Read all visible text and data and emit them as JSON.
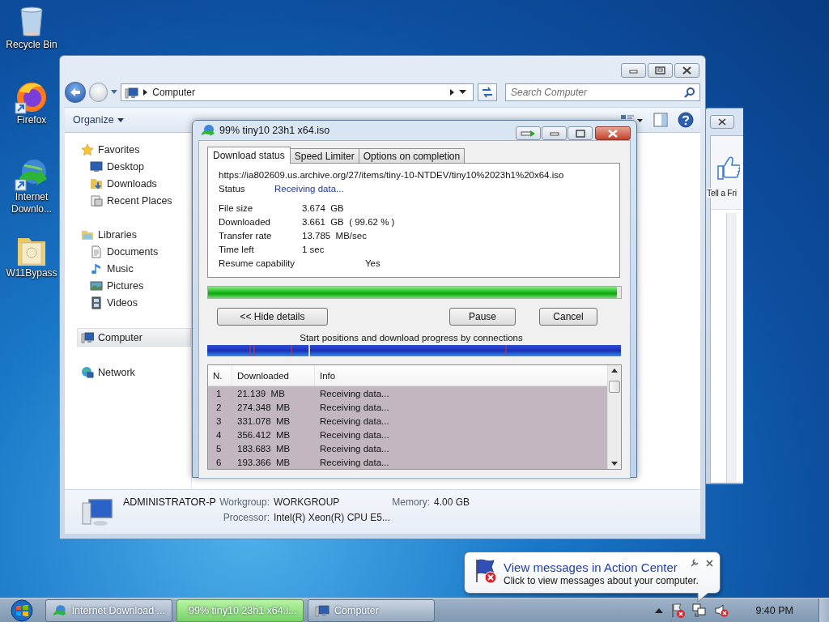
{
  "desktop_icons": [
    {
      "label": "Recycle Bin"
    },
    {
      "label": "Firefox"
    },
    {
      "label": "Internet Downlo..."
    },
    {
      "label": "W11Bypass"
    }
  ],
  "explorer": {
    "address": "Computer",
    "search": {
      "placeholder": "Search Computer"
    },
    "toolbar": [
      "Organize"
    ],
    "nav": [
      {
        "label": "Favorites",
        "selected": false,
        "children": [
          {
            "label": "Desktop",
            "selected": false
          },
          {
            "label": "Downloads",
            "selected": false
          },
          {
            "label": "Recent Places",
            "selected": false
          }
        ]
      },
      {
        "label": "Libraries",
        "selected": false,
        "children": [
          {
            "label": "Documents",
            "selected": false
          },
          {
            "label": "Music",
            "selected": false
          },
          {
            "label": "Pictures",
            "selected": false
          },
          {
            "label": "Videos",
            "selected": false
          }
        ]
      },
      {
        "label": "Computer",
        "selected": true
      },
      {
        "label": "Network",
        "selected": false
      }
    ],
    "details": {
      "name": "ADMINISTRATOR-P",
      "fields": [
        {
          "label": "Workgroup:",
          "value": "WORKGROUP"
        },
        {
          "label": "Memory:",
          "value": "4.00 GB"
        },
        {
          "label": "Processor:",
          "value": "Intel(R) Xeon(R) CPU E5..."
        }
      ]
    }
  },
  "back_window": {
    "label": "Tell a Fri"
  },
  "download_dialog": {
    "title": "99% tiny10 23h1 x64.iso",
    "tabs": [
      {
        "label": "Download status",
        "selected": true
      },
      {
        "label": "Speed Limiter",
        "selected": false
      },
      {
        "label": "Options on completion",
        "selected": false
      }
    ],
    "url": "https://ia802609.us.archive.org/27/items/tiny-10-NTDEV/tiny10%2023h1%20x64.iso",
    "status": {
      "label": "Status",
      "value": "Receiving data..."
    },
    "info": [
      {
        "label": "File size",
        "value": "3.674  GB",
        "kind": "field"
      },
      {
        "label": "Downloaded",
        "value": "3.661  GB  ( 99.62 % )",
        "kind": "field"
      },
      {
        "label": "Transfer rate",
        "value": "13.785  MB/sec",
        "kind": "field"
      },
      {
        "label": "Time left",
        "value": "1 sec",
        "kind": "field"
      },
      {
        "label": "Resume capability",
        "value": "Yes",
        "kind": "flag"
      }
    ],
    "progress": {
      "level": 0.99
    },
    "buttons": [
      "<< Hide details",
      "Pause",
      "Cancel"
    ],
    "connections_caption": "Start positions and download progress by connections",
    "table": {
      "columns": [
        "N.",
        "Downloaded",
        "Info"
      ],
      "rows": [
        [
          "1",
          "21.139  MB",
          "Receiving data..."
        ],
        [
          "2",
          "274.348  MB",
          "Receiving data..."
        ],
        [
          "3",
          "331.078  MB",
          "Receiving data..."
        ],
        [
          "4",
          "356.412  MB",
          "Receiving data..."
        ],
        [
          "5",
          "183.683  MB",
          "Receiving data..."
        ],
        [
          "6",
          "193.366  MB",
          "Receiving data..."
        ]
      ]
    }
  },
  "taskbar": {
    "buttons": [
      {
        "label": "Internet Download ...",
        "selected": false
      },
      {
        "label": "99% tiny10 23h1 x64.i...",
        "selected": true
      },
      {
        "label": "Computer",
        "selected": false
      }
    ],
    "clock": "9:40 PM"
  },
  "notification": {
    "title": "View messages in Action Center",
    "text": "Click to view messages about your computer."
  }
}
